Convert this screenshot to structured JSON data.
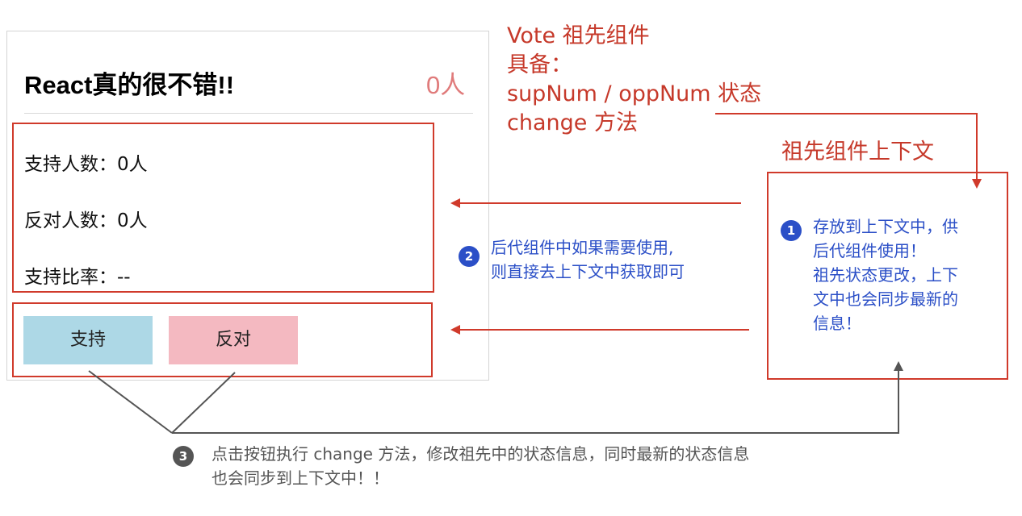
{
  "vote": {
    "title": "React真的很不错!!",
    "total": "0人",
    "support_line": "支持人数：0人",
    "oppose_line": "反对人数：0人",
    "ratio_line": "支持比率：--",
    "support_button": "支持",
    "oppose_button": "反对"
  },
  "ancestor_note": {
    "line1": "Vote 祖先组件",
    "line2": "具备：",
    "line3": "supNum / oppNum 状态",
    "line4": "change 方法"
  },
  "context_box": {
    "title": "祖先组件上下文",
    "badge": "1",
    "lines": [
      "存放到上下文中，供",
      "后代组件使用！",
      "祖先状态更改，上下",
      "文中也会同步最新的",
      "信息！"
    ]
  },
  "descendant_note": {
    "badge": "2",
    "lines": [
      "后代组件中如果需要使用,",
      "则直接去上下文中获取即可"
    ]
  },
  "click_note": {
    "badge": "3",
    "lines": [
      "点击按钮执行 change 方法，修改祖先中的状态信息，同时最新的状态信息",
      "也会同步到上下文中！！"
    ]
  },
  "colors": {
    "red": "#d03a2b",
    "blue": "#2b4fc7",
    "gray": "#555555",
    "support_bg": "#add8e6",
    "oppose_bg": "#f4b9c1"
  }
}
